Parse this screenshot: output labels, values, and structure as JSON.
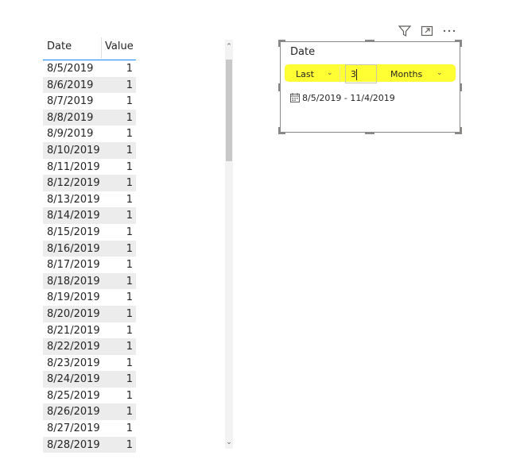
{
  "table": {
    "headers": {
      "date": "Date",
      "value": "Value"
    },
    "rows": [
      {
        "date": "8/5/2019",
        "value": "1"
      },
      {
        "date": "8/6/2019",
        "value": "1"
      },
      {
        "date": "8/7/2019",
        "value": "1"
      },
      {
        "date": "8/8/2019",
        "value": "1"
      },
      {
        "date": "8/9/2019",
        "value": "1"
      },
      {
        "date": "8/10/2019",
        "value": "1"
      },
      {
        "date": "8/11/2019",
        "value": "1"
      },
      {
        "date": "8/12/2019",
        "value": "1"
      },
      {
        "date": "8/13/2019",
        "value": "1"
      },
      {
        "date": "8/14/2019",
        "value": "1"
      },
      {
        "date": "8/15/2019",
        "value": "1"
      },
      {
        "date": "8/16/2019",
        "value": "1"
      },
      {
        "date": "8/17/2019",
        "value": "1"
      },
      {
        "date": "8/18/2019",
        "value": "1"
      },
      {
        "date": "8/19/2019",
        "value": "1"
      },
      {
        "date": "8/20/2019",
        "value": "1"
      },
      {
        "date": "8/21/2019",
        "value": "1"
      },
      {
        "date": "8/22/2019",
        "value": "1"
      },
      {
        "date": "8/23/2019",
        "value": "1"
      },
      {
        "date": "8/24/2019",
        "value": "1"
      },
      {
        "date": "8/25/2019",
        "value": "1"
      },
      {
        "date": "8/26/2019",
        "value": "1"
      },
      {
        "date": "8/27/2019",
        "value": "1"
      },
      {
        "date": "8/28/2019",
        "value": "1"
      }
    ]
  },
  "scrollbar": {
    "up_glyph": "^",
    "down_glyph": "v"
  },
  "header_icons": [
    "filter-icon",
    "focus-mode-icon",
    "more-options-icon"
  ],
  "slicer": {
    "title": "Date",
    "relative_dropdown": "Last",
    "number_input": "3",
    "unit_dropdown": "Months",
    "date_range": "8/5/2019 - 11/4/2019",
    "calendar_icon": "calendar-icon"
  },
  "colors": {
    "highlight": "#ffff33",
    "header_underline": "#118dff",
    "row_stripe": "#ececec"
  }
}
